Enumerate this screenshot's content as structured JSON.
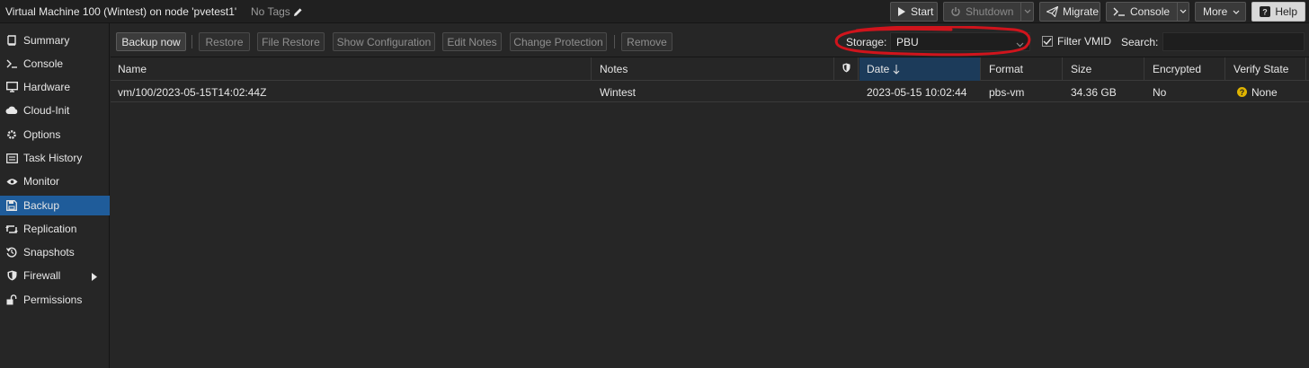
{
  "header": {
    "title": "Virtual Machine 100 (Wintest) on node 'pvetest1'",
    "tags": "No Tags",
    "buttons": {
      "start": "Start",
      "shutdown": "Shutdown",
      "migrate": "Migrate",
      "console": "Console",
      "more": "More",
      "help": "Help"
    }
  },
  "sidebar": {
    "items": [
      {
        "label": "Summary",
        "icon": "book-icon"
      },
      {
        "label": "Console",
        "icon": "terminal-icon"
      },
      {
        "label": "Hardware",
        "icon": "desktop-icon"
      },
      {
        "label": "Cloud-Init",
        "icon": "cloud-icon"
      },
      {
        "label": "Options",
        "icon": "gear-icon"
      },
      {
        "label": "Task History",
        "icon": "list-icon"
      },
      {
        "label": "Monitor",
        "icon": "eye-icon"
      },
      {
        "label": "Backup",
        "icon": "floppy-icon",
        "active": true
      },
      {
        "label": "Replication",
        "icon": "retweet-icon"
      },
      {
        "label": "Snapshots",
        "icon": "history-icon"
      },
      {
        "label": "Firewall",
        "icon": "shield-icon"
      },
      {
        "label": "Permissions",
        "icon": "unlock-icon"
      }
    ]
  },
  "toolbar": {
    "backup_now": "Backup now",
    "restore": "Restore",
    "file_restore": "File Restore",
    "show_configuration": "Show Configuration",
    "edit_notes": "Edit Notes",
    "change_protection": "Change Protection",
    "remove": "Remove",
    "storage_label": "Storage:",
    "storage_value": "PBU",
    "filter_vmid_label": "Filter VMID",
    "filter_vmid_checked": true,
    "search_label": "Search:",
    "search_value": ""
  },
  "grid": {
    "columns": {
      "name": "Name",
      "notes": "Notes",
      "date": "Date",
      "format": "Format",
      "size": "Size",
      "encrypted": "Encrypted",
      "verify_state": "Verify State"
    },
    "sorted_column": "Date",
    "sort_direction": "descending",
    "rows": [
      {
        "name": "vm/100/2023-05-15T14:02:44Z",
        "notes": "Wintest",
        "date": "2023-05-15 10:02:44",
        "format": "pbs-vm",
        "size": "34.36 GB",
        "encrypted": "No",
        "verify_state": "None"
      }
    ]
  },
  "colors": {
    "background": "#262626",
    "header_bg": "#202020",
    "active_nav": "#1f5c9a",
    "sorted_header": "#1c3b5a",
    "annotation": "#d0141c",
    "verify_warning": "#e0b400"
  }
}
